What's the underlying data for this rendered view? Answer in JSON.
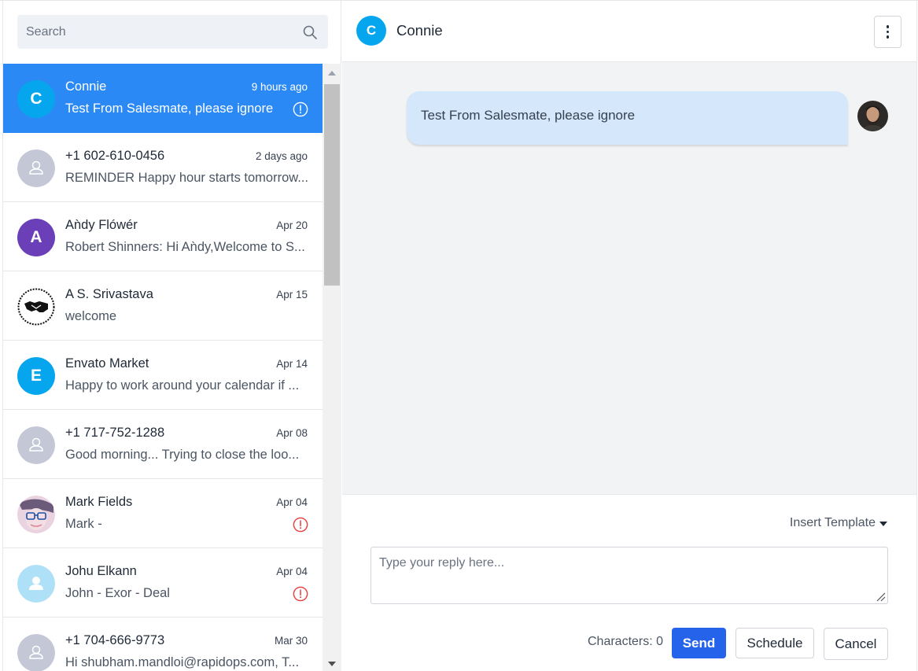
{
  "search": {
    "placeholder": "Search"
  },
  "conversations": [
    {
      "initial": "C",
      "avatar_color": "#06a6ef",
      "avatar_type": "initial",
      "name": "Connie",
      "time": "9 hours ago",
      "preview": "Test From Salesmate, please ignore",
      "alert": true,
      "active": true
    },
    {
      "initial": "",
      "avatar_color": "#c4c8d6",
      "avatar_type": "user-outline",
      "name": "+1 602-610-0456",
      "time": "2 days ago",
      "preview": "REMINDER Happy hour starts tomorrow...",
      "alert": false
    },
    {
      "initial": "A",
      "avatar_color": "#6a3fb8",
      "avatar_type": "initial",
      "name": "Aǹdy Flówér",
      "time": "Apr 20",
      "preview": "Robert Shinners: Hi Aǹdy,Welcome to S...",
      "alert": false
    },
    {
      "initial": "",
      "avatar_color": "#ffffff",
      "avatar_type": "handshake",
      "name": "A S. Srivastava",
      "time": "Apr 15",
      "preview": "welcome",
      "alert": false
    },
    {
      "initial": "E",
      "avatar_color": "#06a6ef",
      "avatar_type": "initial",
      "name": "Envato Market",
      "time": "Apr 14",
      "preview": "Happy to work around your calendar if ...",
      "alert": false
    },
    {
      "initial": "",
      "avatar_color": "#c4c8d6",
      "avatar_type": "user-outline",
      "name": "+1 717-752-1288",
      "time": "Apr 08",
      "preview": "Good morning... Trying to close the loo...",
      "alert": false
    },
    {
      "initial": "",
      "avatar_color": "#e9d3e0",
      "avatar_type": "photo-glasses",
      "name": "Mark Fields",
      "time": "Apr 04",
      "preview": "Mark -",
      "alert": true
    },
    {
      "initial": "",
      "avatar_color": "#aee0f8",
      "avatar_type": "user-solid",
      "name": "Johu Elkann",
      "time": "Apr 04",
      "preview": "John - Exor - Deal",
      "alert": true
    },
    {
      "initial": "",
      "avatar_color": "#c4c8d6",
      "avatar_type": "user-outline",
      "name": "+1 704-666-9773",
      "time": "Mar 30",
      "preview": "Hi shubham.mandloi@rapidops.com, T...",
      "alert": false
    }
  ],
  "chat": {
    "contact_initial": "C",
    "contact_name": "Connie",
    "messages": [
      {
        "text": "Test From Salesmate, please ignore",
        "direction": "outgoing"
      }
    ]
  },
  "composer": {
    "insert_template_label": "Insert Template",
    "reply_placeholder": "Type your reply here...",
    "characters_label": "Characters: 0",
    "send_label": "Send",
    "schedule_label": "Schedule",
    "cancel_label": "Cancel"
  },
  "colors": {
    "accent": "#2b89f5",
    "send": "#2563eb",
    "alert_active": "#ffffff",
    "alert": "#e53e3e",
    "bubble": "#d4e7fb"
  }
}
